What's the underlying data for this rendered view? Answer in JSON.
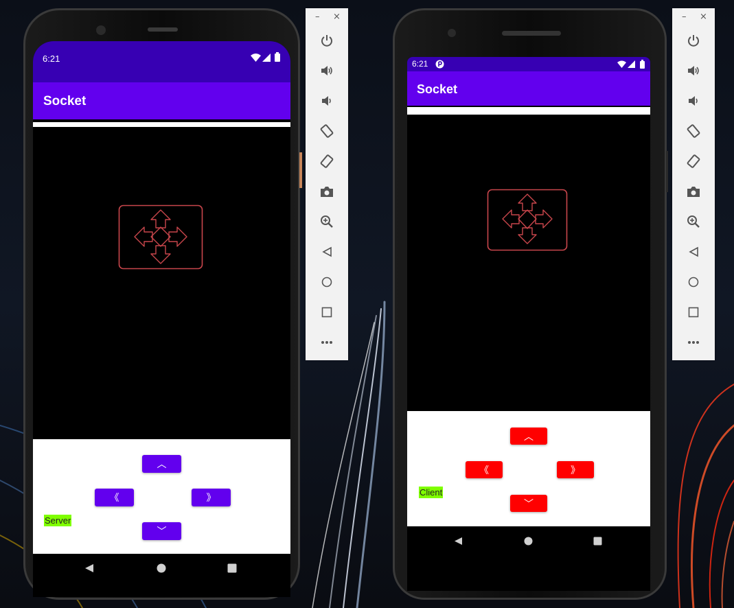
{
  "left_device": {
    "status_time": "6:21",
    "app_title": "Socket",
    "buttons": {
      "up": "︿",
      "left": "《",
      "right": "》",
      "down": "﹀"
    },
    "role_label": "Server",
    "accent_color": "#6200ee"
  },
  "right_device": {
    "status_time": "6:21",
    "app_title": "Socket",
    "buttons": {
      "up": "︿",
      "left": "《",
      "right": "》",
      "down": "﹀"
    },
    "role_label": "Client",
    "accent_color": "#ff0000"
  },
  "emulator_toolbar": {
    "window_controls": [
      "–",
      "×"
    ],
    "tools": [
      "power-icon",
      "volume-up-icon",
      "volume-down-icon",
      "rotate-left-icon",
      "rotate-right-icon",
      "camera-icon",
      "zoom-icon",
      "back-icon",
      "home-icon",
      "overview-icon",
      "more-icon"
    ]
  }
}
